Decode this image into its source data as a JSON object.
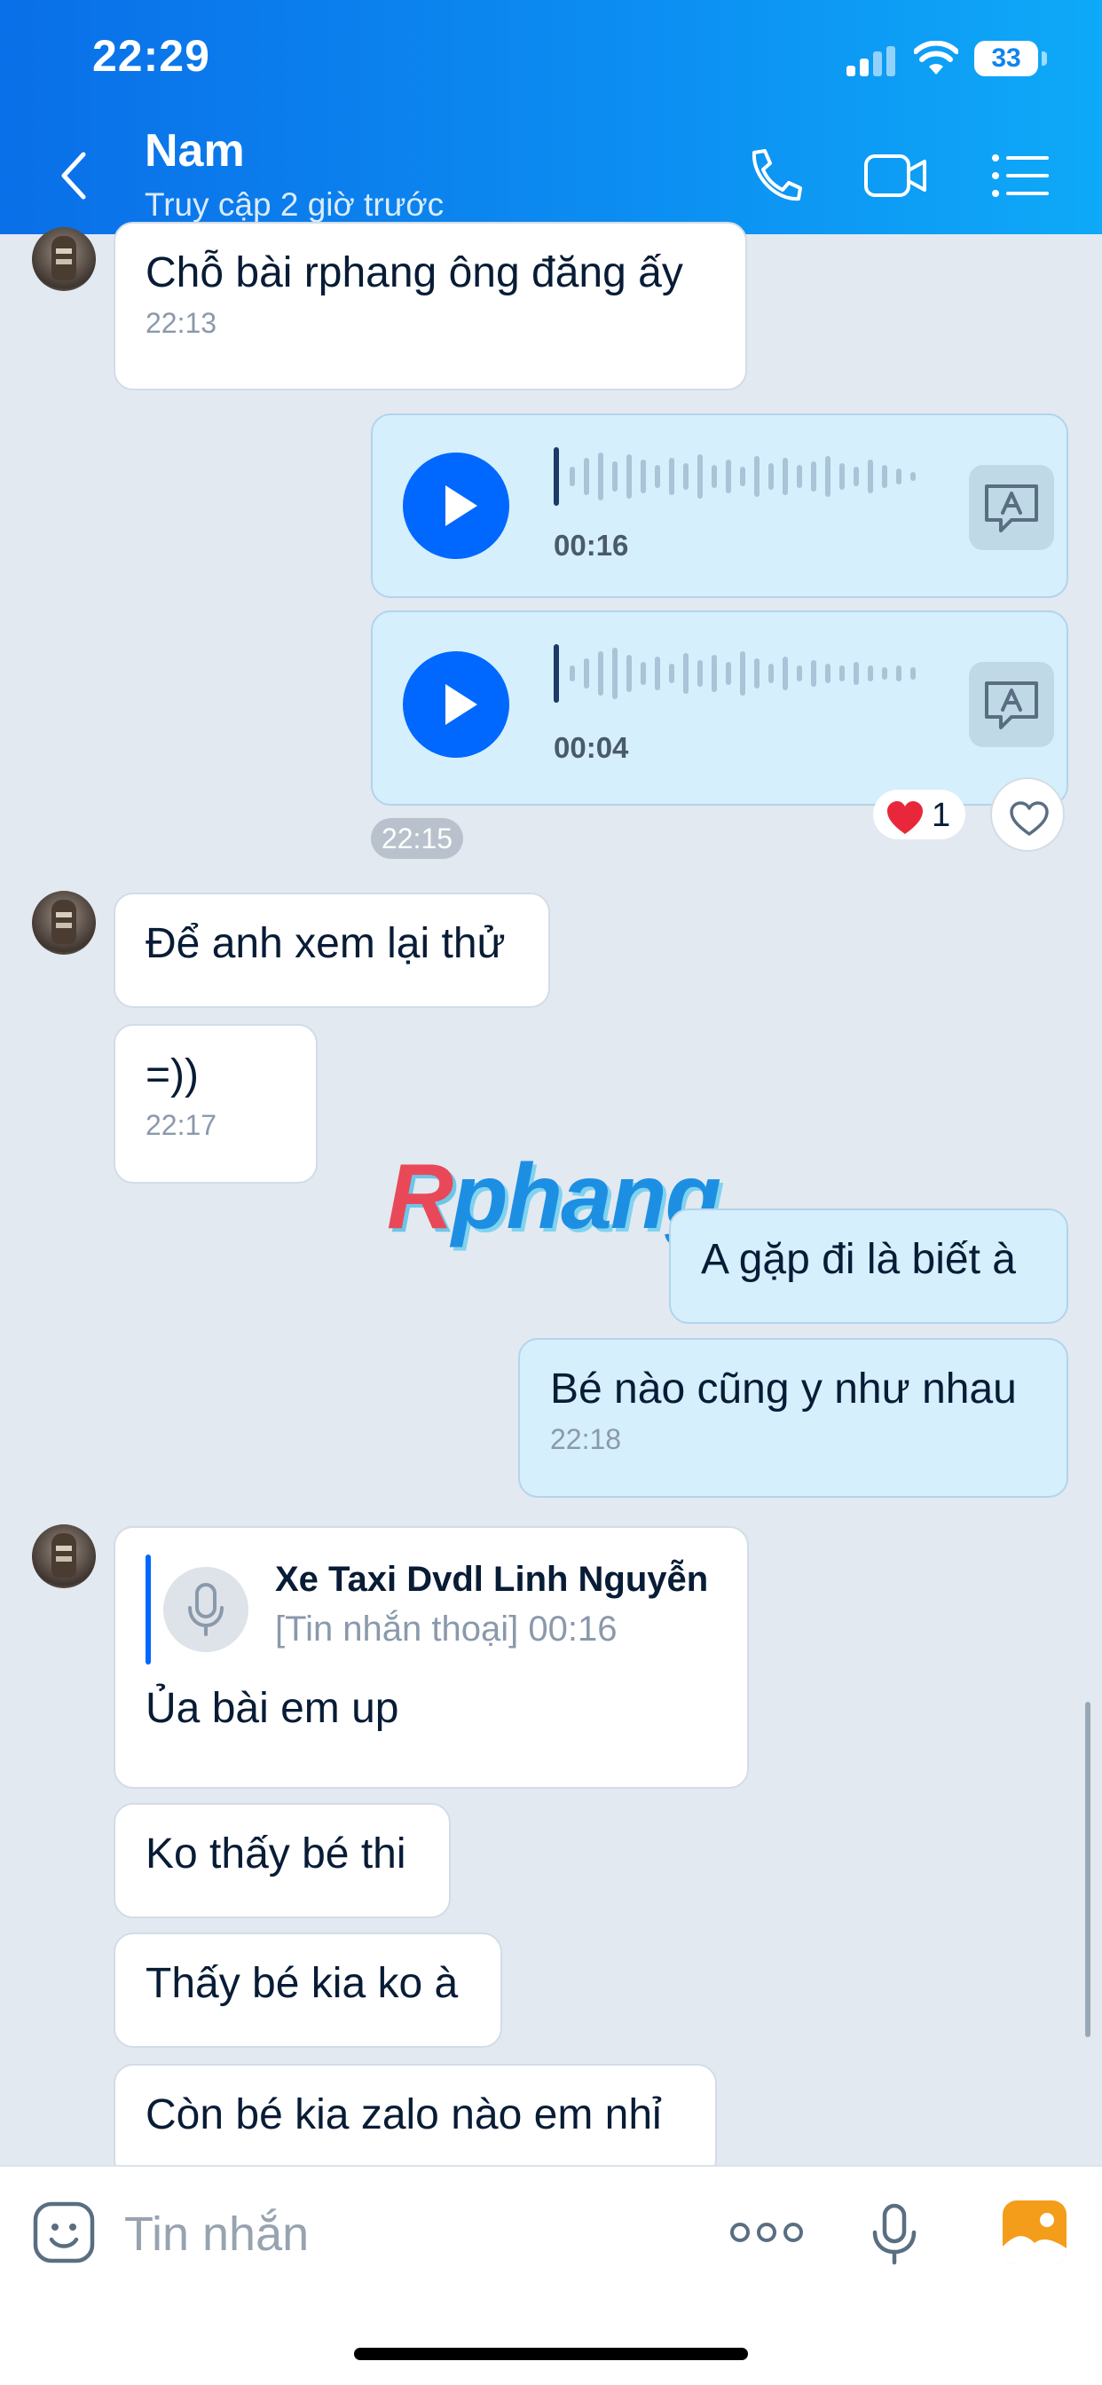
{
  "status_bar": {
    "time": "22:29",
    "battery": "33"
  },
  "header": {
    "name": "Nam",
    "status": "Truy cập 2 giờ trước"
  },
  "messages": {
    "m1": {
      "text": "Chỗ bài rphang ông đăng ấy",
      "time": "22:13"
    },
    "voice1": {
      "duration": "00:16"
    },
    "voice2": {
      "duration": "00:04"
    },
    "voice_time": "22:15",
    "reaction_count": "1",
    "m2": {
      "text": "Để anh xem lại thử"
    },
    "m3": {
      "text": "=))",
      "time": "22:17"
    },
    "m4": {
      "text": "A gặp đi là biết à"
    },
    "m5": {
      "text": "Bé nào cũng y như nhau",
      "time": "22:18"
    },
    "m6": {
      "quote_name": "Xe Taxi Dvdl Linh Nguyễn",
      "quote_text": "[Tin nhắn thoại] 00:16",
      "text": "Ủa bài em up"
    },
    "m7": {
      "text": "Ko thấy bé thi"
    },
    "m8": {
      "text": "Thấy bé kia ko à"
    },
    "m9": {
      "text": "Còn bé kia zalo nào em nhỉ"
    }
  },
  "watermark": {
    "a": "R",
    "b": "phang"
  },
  "input": {
    "placeholder": "Tin nhắn"
  },
  "colors": {
    "accent": "#0068ff",
    "header_from": "#0a6fe8",
    "header_to": "#0ea9f8",
    "out_bubble": "#d5effd",
    "reaction": "#e8283a"
  },
  "icons": [
    "back-chevron-icon",
    "phone-icon",
    "video-call-icon",
    "list-menu-icon",
    "play-icon",
    "transcribe-icon",
    "heart-icon",
    "mic-icon",
    "emoji-icon",
    "more-dots-icon",
    "image-icon"
  ]
}
